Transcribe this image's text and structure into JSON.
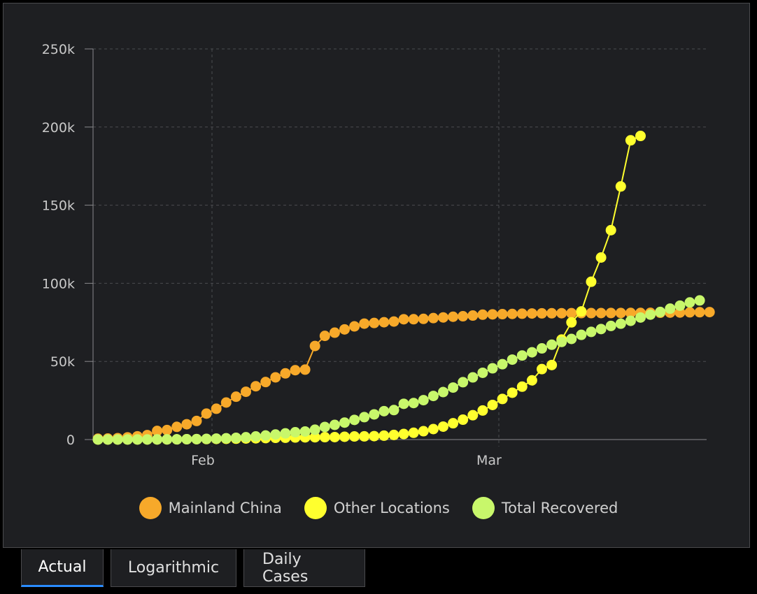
{
  "chart_data": {
    "type": "line",
    "x_labels": [
      "Feb",
      "Mar"
    ],
    "y_ticks": [
      "0",
      "50k",
      "100k",
      "150k",
      "200k",
      "250k"
    ],
    "ylim": [
      0,
      250000
    ],
    "grid": true,
    "legend_position": "bottom",
    "start_date": "2020-01-22",
    "series": [
      {
        "name": "Mainland China",
        "color": "#f7a92a",
        "values": [
          548,
          643,
          920,
          1406,
          2075,
          2877,
          5509,
          6087,
          8141,
          9802,
          11891,
          16630,
          19716,
          23707,
          27440,
          30587,
          34110,
          36814,
          39829,
          42354,
          44386,
          44759,
          59895,
          66358,
          68413,
          70513,
          72434,
          74211,
          74619,
          75077,
          75550,
          77001,
          77022,
          77241,
          77754,
          78166,
          78600,
          78928,
          79356,
          79932,
          80136,
          80261,
          80386,
          80537,
          80690,
          80770,
          80823,
          80860,
          80887,
          80921,
          80932,
          80945,
          80977,
          81003,
          81033,
          81058,
          81102,
          81156,
          81250,
          81305,
          81435,
          81498,
          81591
        ]
      },
      {
        "name": "Other Locations",
        "color": "#ffff2e",
        "values": [
          7,
          11,
          21,
          28,
          43,
          59,
          72,
          104,
          152,
          208,
          259,
          310,
          401,
          452,
          539,
          673,
          805,
          928,
          1095,
          1166,
          1335,
          1397,
          1465,
          1544,
          1578,
          1807,
          1987,
          2058,
          2196,
          2505,
          2956,
          3563,
          4339,
          5359,
          6708,
          8282,
          10440,
          12734,
          15580,
          18609,
          22153,
          25985,
          29966,
          33866,
          37900,
          45105,
          47692,
          64000,
          75000,
          82000,
          101000,
          116500,
          134000,
          162000,
          191500,
          194300
        ]
      },
      {
        "name": "Total Recovered",
        "color": "#c8f76b",
        "values": [
          28,
          30,
          36,
          39,
          52,
          61,
          107,
          126,
          143,
          222,
          284,
          472,
          623,
          852,
          1124,
          1487,
          2011,
          2616,
          3244,
          3946,
          4683,
          5150,
          6295,
          8058,
          9395,
          10865,
          12583,
          14352,
          16121,
          18177,
          18890,
          22886,
          23394,
          25227,
          27905,
          30384,
          33277,
          36711,
          39782,
          42716,
          45602,
          48228,
          51170,
          53796,
          55865,
          58359,
          60694,
          62494,
          64404,
          67003,
          68907,
          70725,
          72703,
          74173,
          75970,
          78120,
          79946,
          81668,
          83784,
          85726,
          87764,
          89032
        ]
      }
    ]
  },
  "tabs": [
    {
      "label": "Actual",
      "active": true
    },
    {
      "label": "Logarithmic",
      "active": false
    },
    {
      "label": "Daily Cases",
      "active": false
    }
  ]
}
